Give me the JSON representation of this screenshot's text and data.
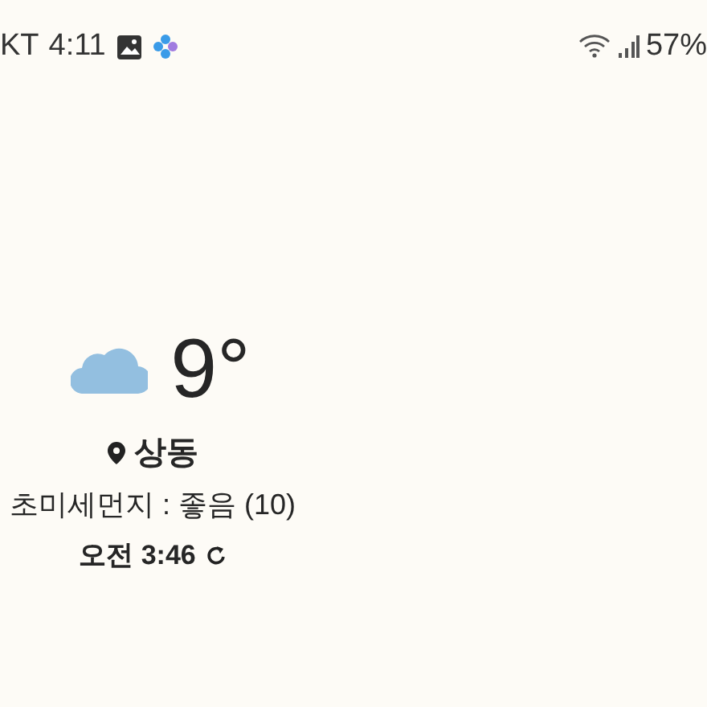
{
  "status_bar": {
    "carrier": "KT",
    "time": "4:11",
    "battery": "57%"
  },
  "weather": {
    "temperature": "9°",
    "location": "상동",
    "air_quality": "초미세먼지 : 좋음 (10)",
    "updated": "오전 3:46"
  }
}
